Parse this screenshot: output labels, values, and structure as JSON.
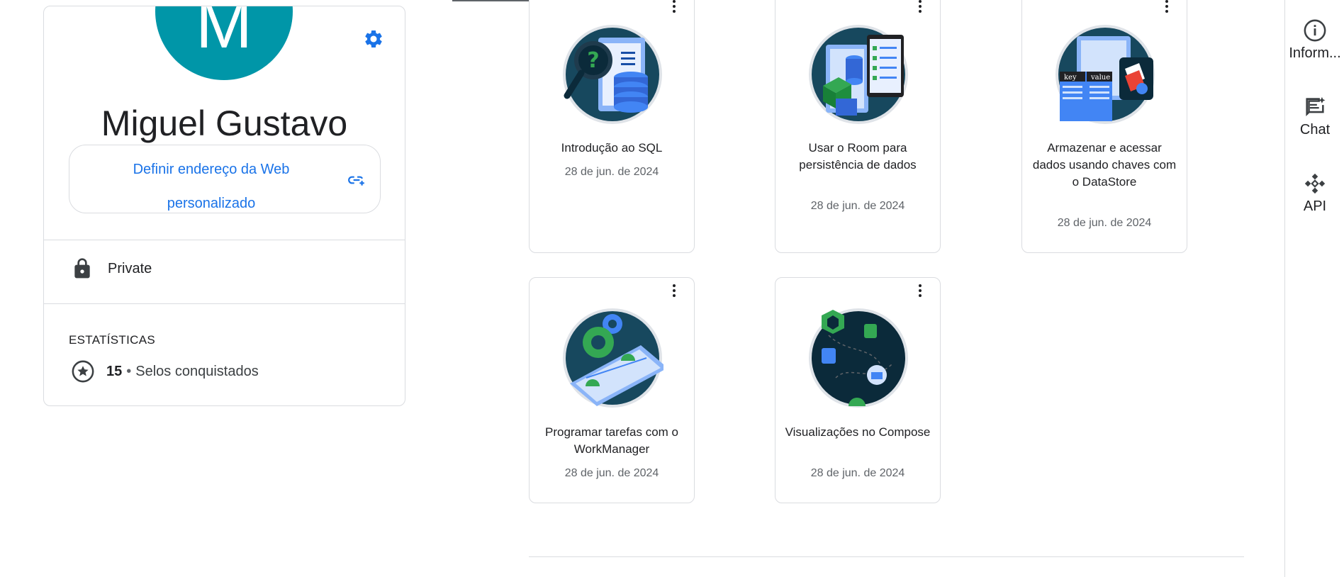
{
  "profile": {
    "avatar_letter": "M",
    "name": "Miguel Gustavo",
    "web_address_label": "Definir endereço da Web personalizado",
    "privacy": "Private",
    "stats_heading": "ESTATÍSTICAS",
    "badge_count": "15",
    "separator": "•",
    "badge_count_label": "Selos conquistados",
    "colors": {
      "avatar_bg": "#0096a8",
      "link": "#1a73e8"
    }
  },
  "badges": [
    {
      "title": "Introdução ao SQL",
      "date": "28 de jun. de 2024",
      "icon": "sql-badge-icon"
    },
    {
      "title": "Usar o Room para persistência de dados",
      "date": "28 de jun. de 2024",
      "icon": "room-badge-icon"
    },
    {
      "title": "Armazenar e acessar dados usando chaves com o DataStore",
      "date": "28 de jun. de 2024",
      "icon": "datastore-badge-icon",
      "image_labels": [
        "key",
        "value"
      ]
    },
    {
      "title": "Programar tarefas com o WorkManager",
      "date": "28 de jun. de 2024",
      "icon": "workmanager-badge-icon"
    },
    {
      "title": "Visualizações no Compose",
      "date": "28 de jun. de 2024",
      "icon": "compose-badge-icon"
    }
  ],
  "side_panel": {
    "items": [
      {
        "label": "Inform...",
        "icon": "info-icon"
      },
      {
        "label": "Chat",
        "icon": "chat-icon"
      },
      {
        "label": "API",
        "icon": "api-icon"
      }
    ]
  }
}
